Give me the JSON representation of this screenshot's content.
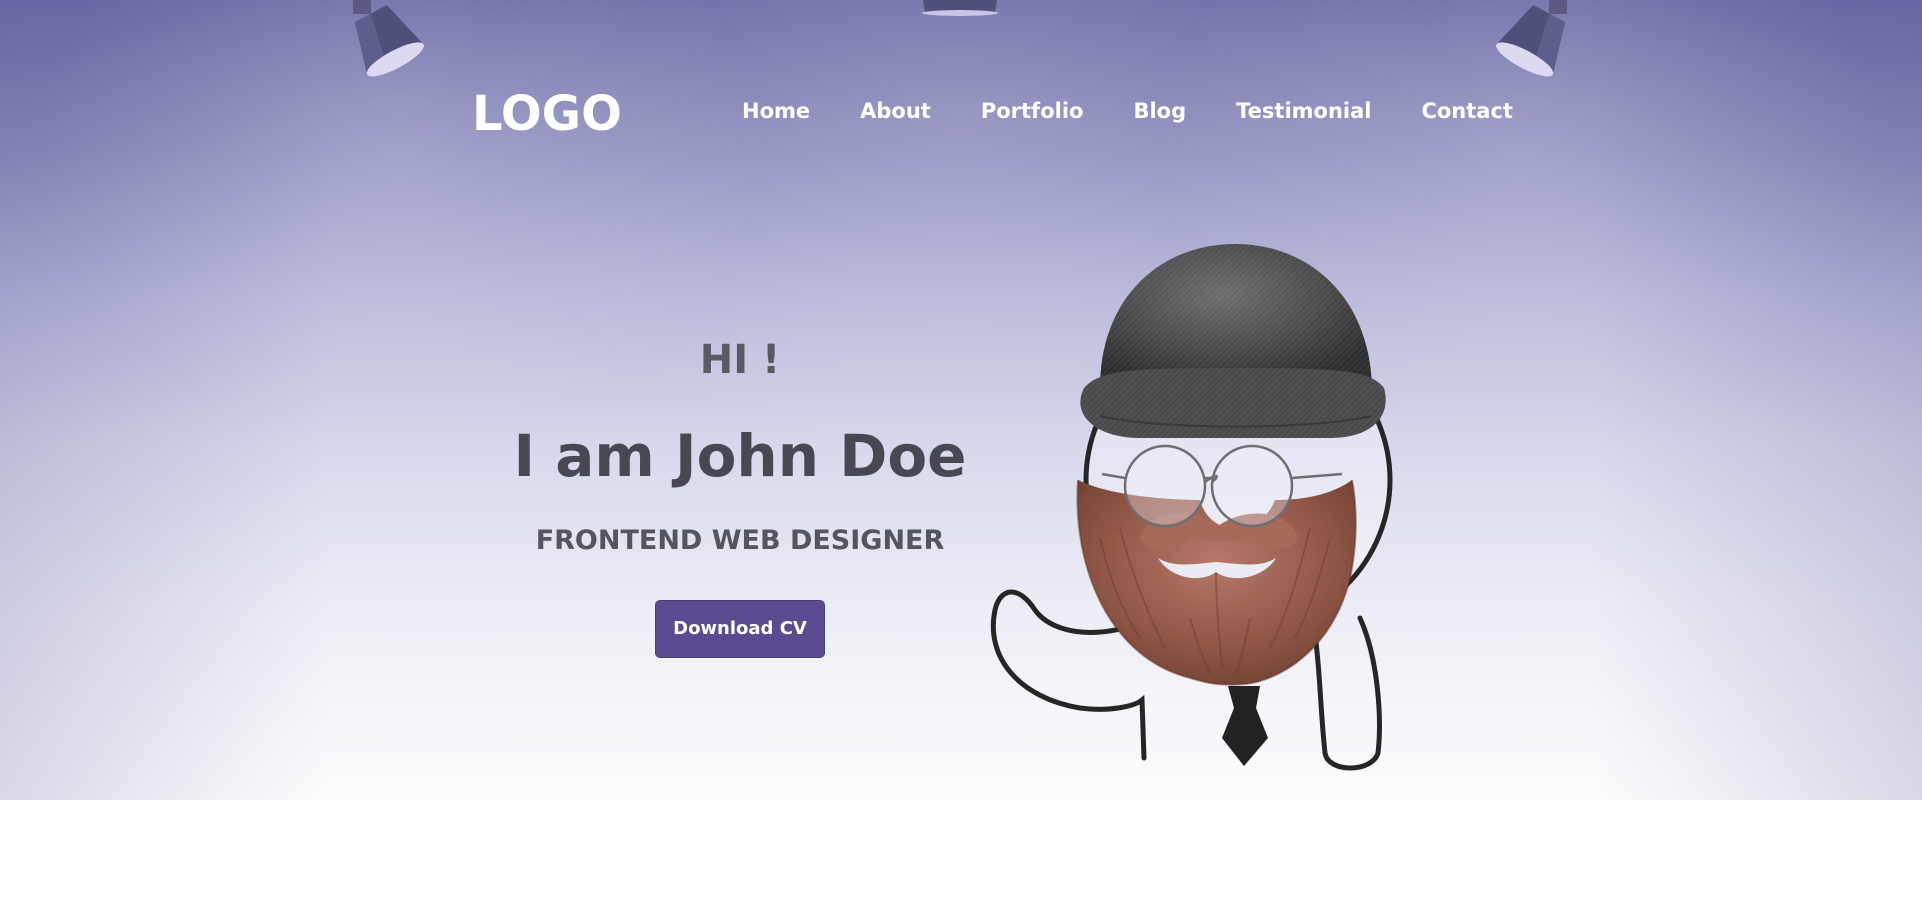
{
  "header": {
    "logo": "LOGO",
    "menu": [
      {
        "label": "Home"
      },
      {
        "label": "About"
      },
      {
        "label": "Portfolio"
      },
      {
        "label": "Blog"
      },
      {
        "label": "Testimonial"
      },
      {
        "label": "Contact"
      }
    ]
  },
  "hero": {
    "greeting": "HI !",
    "name": "I am John Doe",
    "role": "FRONTEND WEB DESIGNER",
    "download_button": "Download CV"
  },
  "colors": {
    "accent": "#5a4a8f",
    "heading": "#484853",
    "nav_text": "#ffffff",
    "background_top": "#6a6aa6"
  },
  "icons": {
    "lamps": [
      "spotlight-icon",
      "spotlight-icon",
      "spotlight-icon"
    ],
    "illustration": "bearded-man-illustration"
  }
}
